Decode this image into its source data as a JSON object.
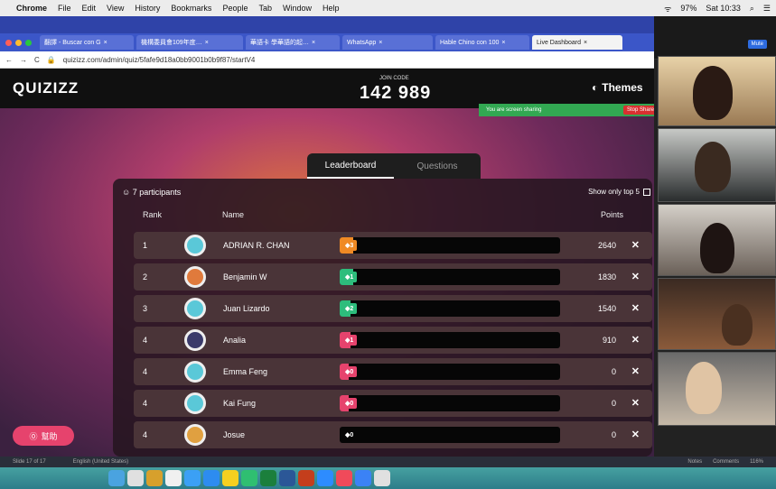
{
  "menubar": {
    "app": "Chrome",
    "items": [
      "File",
      "Edit",
      "View",
      "History",
      "Bookmarks",
      "People",
      "Tab",
      "Window",
      "Help"
    ],
    "battery": "97%",
    "clock": "Sat 10:33"
  },
  "tabs": [
    {
      "label": "翻譯 - Buscar con G",
      "active": false
    },
    {
      "label": "機構委員會109年度… ",
      "active": false
    },
    {
      "label": "華語卡 學華語的起…",
      "active": false
    },
    {
      "label": "WhatsApp",
      "active": false
    },
    {
      "label": "Hable Chino con 100",
      "active": false
    },
    {
      "label": "Live Dashboard",
      "active": true
    }
  ],
  "address": "quizizz.com/admin/quiz/5fafe9d18a0bb9001b0b9f87/startV4",
  "header": {
    "logo": "QUIZIZZ",
    "join_label": "JOIN CODE",
    "join_code": "142 989",
    "themes": "Themes"
  },
  "share": {
    "text": "You are screen sharing",
    "stop": "Stop Share"
  },
  "view_tabs": {
    "leaderboard": "Leaderboard",
    "questions": "Questions"
  },
  "panel": {
    "participants": "7 participants",
    "top5": "Show only top 5",
    "col_rank": "Rank",
    "col_name": "Name",
    "col_points": "Points"
  },
  "rows": [
    {
      "rank": "1",
      "name": "ADRIAN R. CHAN",
      "tag": "3",
      "points": "2640",
      "color": "#f08a24",
      "correct_fraction": 0.06
    },
    {
      "rank": "2",
      "name": "Benjamin W",
      "tag": "1",
      "points": "1830",
      "color": "#2dbd7c",
      "correct_fraction": 0.06
    },
    {
      "rank": "3",
      "name": "Juan Lizardo",
      "tag": "2",
      "points": "1540",
      "color": "#2dbd7c",
      "correct_fraction": 0.05
    },
    {
      "rank": "4",
      "name": "Analia",
      "tag": "1",
      "points": "910",
      "color": "#e6436d",
      "correct_fraction": 0.05
    },
    {
      "rank": "4",
      "name": "Emma Feng",
      "tag": "0",
      "points": "0",
      "color": "#e6436d",
      "correct_fraction": 0.04
    },
    {
      "rank": "4",
      "name": "Kai Fung",
      "tag": "0",
      "points": "0",
      "color": "#e6436d",
      "correct_fraction": 0.04
    },
    {
      "rank": "4",
      "name": "Josue",
      "tag": "0",
      "points": "0",
      "color": "#060606",
      "correct_fraction": 0.0
    }
  ],
  "help": "幫助",
  "statusbar": {
    "slide": "Slide 17 of 17",
    "lang": "English (United States)",
    "notes": "Notes",
    "comments": "Comments",
    "zoom": "116%"
  },
  "zoom": {
    "mute": "Mute"
  }
}
